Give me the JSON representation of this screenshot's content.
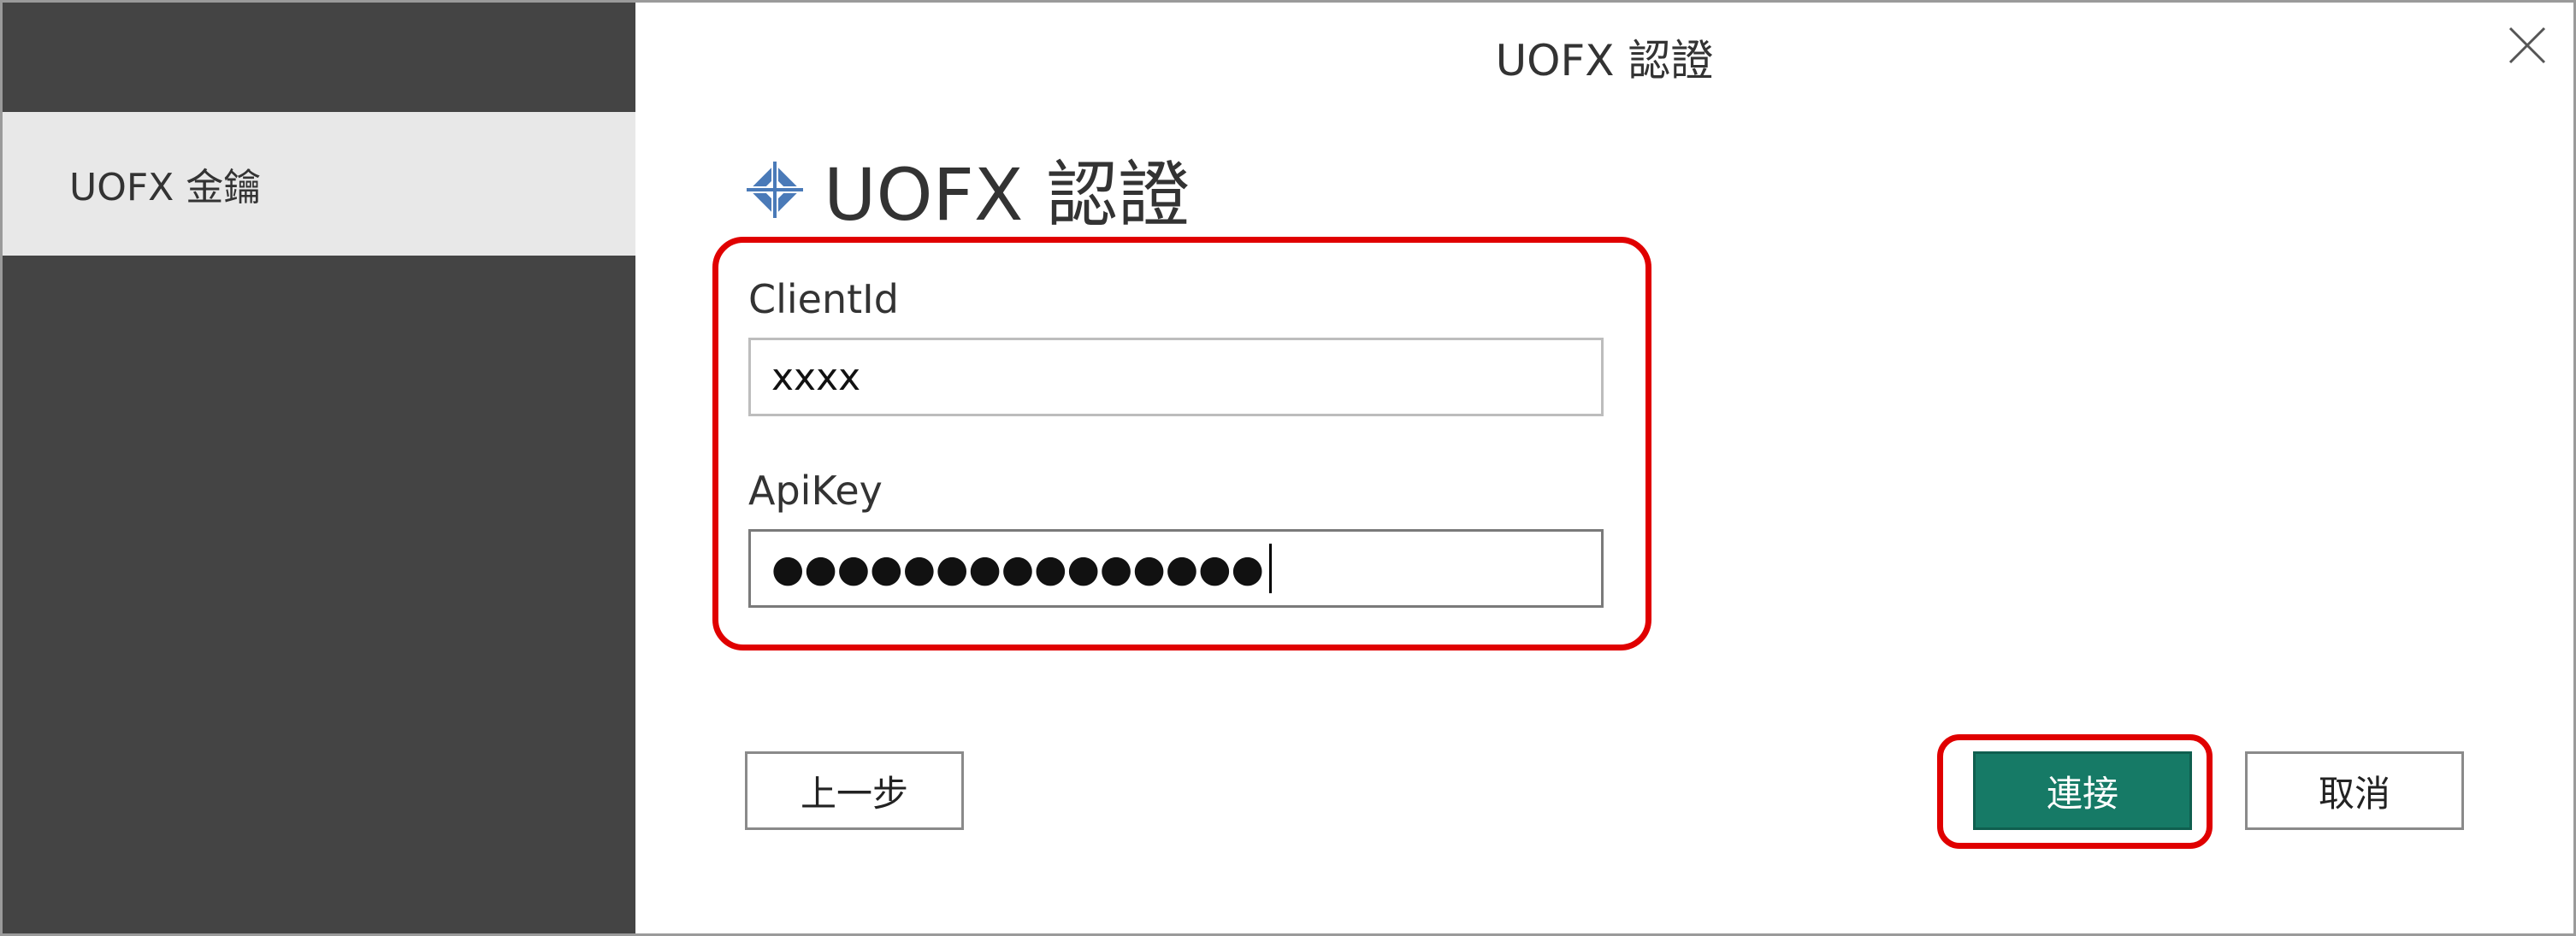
{
  "window": {
    "title": "UOFX 認證",
    "close_icon": "close-icon"
  },
  "sidebar": {
    "items": [
      {
        "label": "UOFX 金鑰",
        "selected": true
      }
    ]
  },
  "main": {
    "heading": "UOFX 認證",
    "heading_icon": "diamond-connector-icon",
    "fields": {
      "client_id": {
        "label": "ClientId",
        "value": "xxxx"
      },
      "api_key": {
        "label": "ApiKey",
        "value": "●●●●●●●●●●●●●●●"
      }
    }
  },
  "buttons": {
    "back_label": "上一步",
    "connect_label": "連接",
    "cancel_label": "取消"
  },
  "colors": {
    "sidebar_bg": "#444444",
    "sidebar_selected_bg": "#e8e8e8",
    "accent": "#167a66",
    "highlight": "#e00000",
    "icon_blue": "#4a7ab8"
  }
}
